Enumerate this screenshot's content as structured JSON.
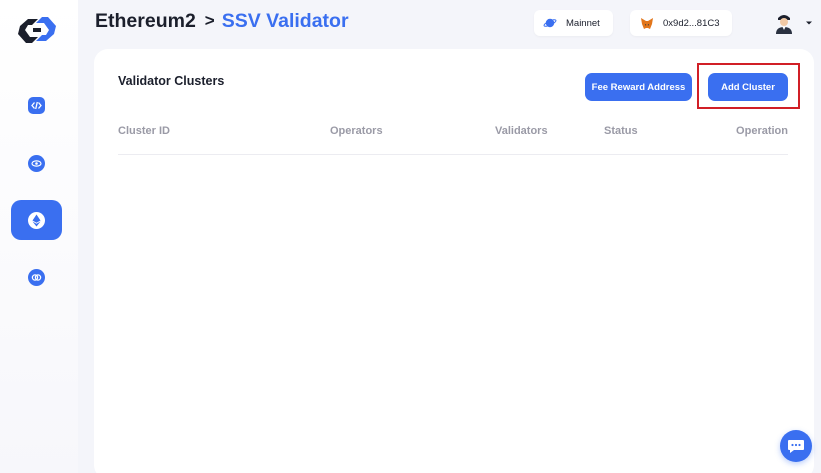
{
  "colors": {
    "accent": "#3a6ff0",
    "text": "#1b1f2c",
    "muted": "#9a9aa6",
    "highlight": "#d11f26"
  },
  "sidebar": {
    "logo_icon": "logo-icon",
    "items": [
      {
        "icon": "code-icon",
        "active": false
      },
      {
        "icon": "eye-icon",
        "active": false
      },
      {
        "icon": "ethereum-icon",
        "active": true
      },
      {
        "icon": "link-icon",
        "active": false
      }
    ]
  },
  "header": {
    "breadcrumb_root": "Ethereum2",
    "breadcrumb_sep": ">",
    "breadcrumb_current": "SSV Validator",
    "network_label": "Mainnet",
    "network_icon": "planet-icon",
    "wallet_address": "0x9d2...81C3",
    "wallet_icon": "metamask-fox-icon",
    "avatar_icon": "user-avatar-icon"
  },
  "main": {
    "title": "Validator Clusters",
    "fee_button": "Fee Reward Address",
    "add_button": "Add Cluster",
    "columns": [
      "Cluster ID",
      "Operators",
      "Validators",
      "Status",
      "Operation"
    ],
    "rows": []
  },
  "chat_icon": "chat-bubble-icon"
}
